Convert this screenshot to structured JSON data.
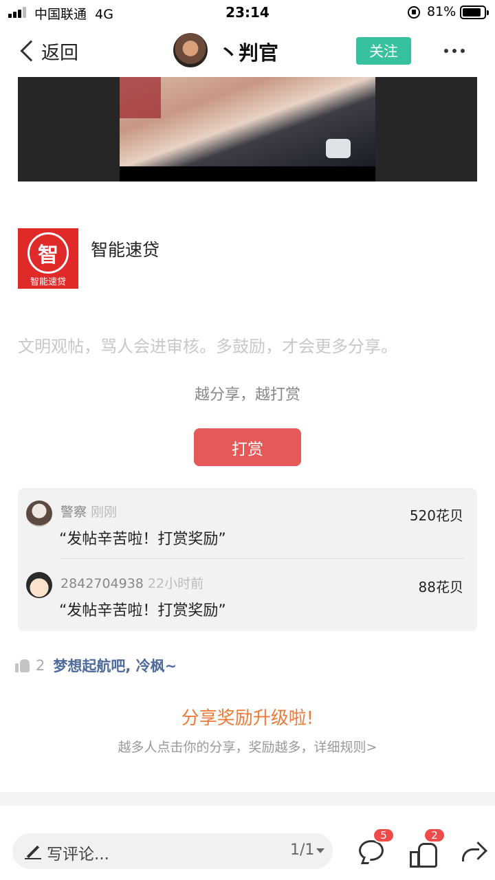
{
  "status_bar": {
    "carrier": "中国联通",
    "network": "4G",
    "time": "23:14",
    "battery": "81%"
  },
  "nav": {
    "back_label": "返回",
    "author_name": "丶判官",
    "follow_label": "关注",
    "follow_color": "#37c19e"
  },
  "ad": {
    "logo_char": "智",
    "logo_caption": "智能速贷",
    "title": "智能速贷"
  },
  "civility_note": "文明观帖，骂人会进审核。多鼓励，才会更多分享。",
  "reward": {
    "hint": "越分享，越打赏",
    "button_label": "打赏",
    "button_color": "#e55a59",
    "rewards": [
      {
        "user": "警察",
        "time": "刚刚",
        "amount": "520花贝",
        "message": "“发帖辛苦啦！打赏奖励”"
      },
      {
        "user": "2842704938",
        "time": "22小时前",
        "amount": "88花贝",
        "message": "“发帖辛苦啦！打赏奖励”"
      }
    ]
  },
  "likes": {
    "count": "2",
    "names": "梦想起航吧, 冷枫~"
  },
  "promo": {
    "title": "分享奖励升级啦!",
    "subtitle": "越多人点击你的分享，奖励越多，详细规则>",
    "title_color": "#ee7a38"
  },
  "bottom_bar": {
    "comment_placeholder": "写评论...",
    "page_indicator": "1/1",
    "comment_badge": "5",
    "like_badge": "2"
  }
}
